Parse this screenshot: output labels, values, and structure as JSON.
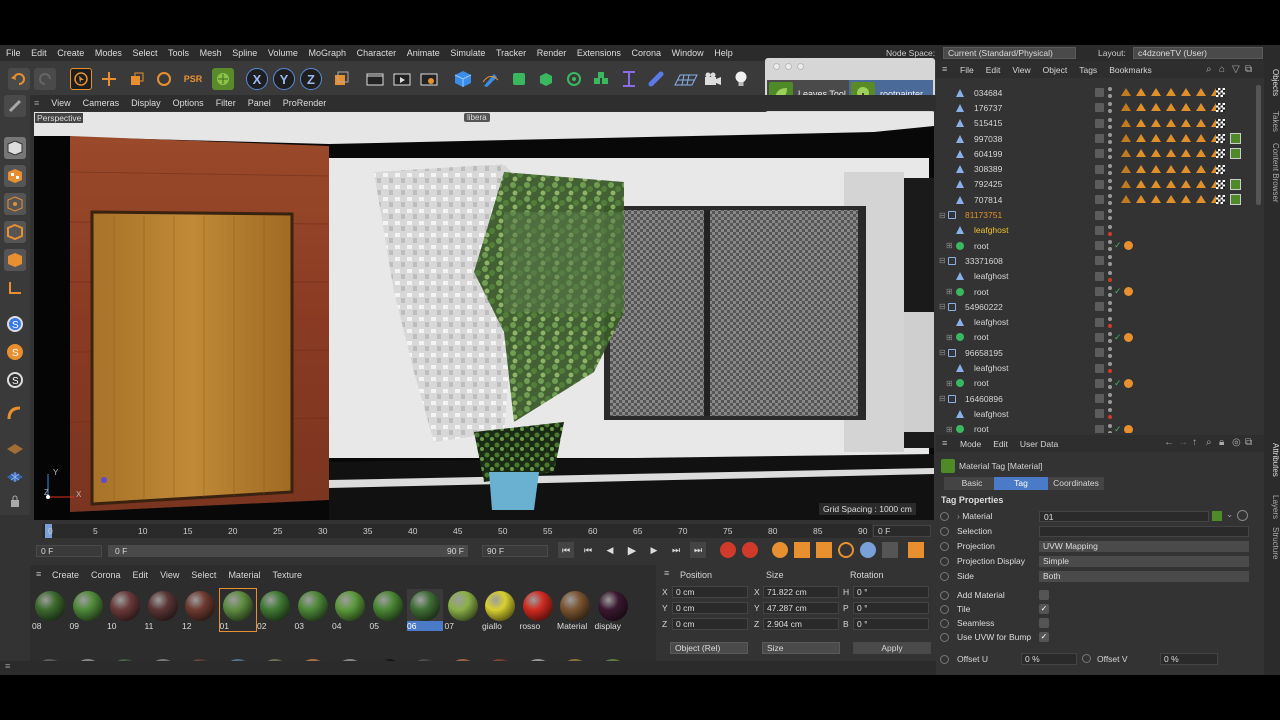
{
  "menubar": {
    "items": [
      "File",
      "Edit",
      "Create",
      "Modes",
      "Select",
      "Tools",
      "Mesh",
      "Spline",
      "Volume",
      "MoGraph",
      "Character",
      "Animate",
      "Simulate",
      "Tracker",
      "Render",
      "Extensions",
      "Corona",
      "Window",
      "Help"
    ],
    "node_space_label": "Node Space:",
    "node_space_value": "Current (Standard/Physical)",
    "layout_label": "Layout:",
    "layout_value": "c4dzoneTV (User)"
  },
  "plugin_panel": {
    "leaves_tool": "Leaves Tool",
    "rootpainter": "rootpainter"
  },
  "viewport": {
    "menu": [
      "View",
      "Cameras",
      "Display",
      "Options",
      "Filter",
      "Panel",
      "ProRender"
    ],
    "camera": "Perspective",
    "grid_spacing": "Grid Spacing : 1000 cm",
    "axis_y": "Y",
    "axis_z": "Z",
    "axis_x": "X",
    "top_label": "libera"
  },
  "timeline": {
    "ticks": [
      "0",
      "5",
      "10",
      "15",
      "20",
      "25",
      "30",
      "35",
      "40",
      "45",
      "50",
      "55",
      "60",
      "65",
      "70",
      "75",
      "80",
      "85",
      "90"
    ],
    "current_frame": "0 F",
    "start_frame": "0 F",
    "preview_start": "0 F",
    "preview_end": "90 F",
    "end_frame": "90 F"
  },
  "material_manager": {
    "menu": [
      "Create",
      "Corona",
      "Edit",
      "View",
      "Select",
      "Material",
      "Texture"
    ],
    "materials": [
      {
        "name": "08",
        "color": "#3d6a2e"
      },
      {
        "name": "09",
        "color": "#4f8a3a"
      },
      {
        "name": "10",
        "color": "#6a3a3a"
      },
      {
        "name": "11",
        "color": "#5a3535"
      },
      {
        "name": "12",
        "color": "#6e3a30"
      },
      {
        "name": "01",
        "color": "#5d8c40"
      },
      {
        "name": "02",
        "color": "#3f7a33"
      },
      {
        "name": "03",
        "color": "#4d8738"
      },
      {
        "name": "04",
        "color": "#5c9a3c"
      },
      {
        "name": "05",
        "color": "#4a8735"
      },
      {
        "name": "06",
        "color": "#3f6e35"
      },
      {
        "name": "07",
        "color": "#8ab048"
      },
      {
        "name": "giallo",
        "color": "#d8d030"
      },
      {
        "name": "rosso",
        "color": "#d02a20"
      },
      {
        "name": "Material",
        "color": "#7a5430"
      },
      {
        "name": "display",
        "color": "#3a1830"
      }
    ],
    "selected_material": "06",
    "second_row_colors": [
      "#555",
      "#888",
      "#3a5a3a",
      "#777",
      "#5a3a30",
      "#4a7090",
      "#6a6a50",
      "#b07040",
      "#8a8a8a",
      "#111",
      "#444",
      "#a06040",
      "#7a3a2a",
      "#999",
      "#8a7030",
      "#5a7a3a"
    ]
  },
  "coordinates": {
    "headers": [
      "Position",
      "Size",
      "Rotation"
    ],
    "rows": [
      {
        "axis": "X",
        "pos": "0 cm",
        "size_axis": "X",
        "size": "71.822 cm",
        "rot_axis": "H",
        "rot": "0 °"
      },
      {
        "axis": "Y",
        "pos": "0 cm",
        "size_axis": "Y",
        "size": "47.287 cm",
        "rot_axis": "P",
        "rot": "0 °"
      },
      {
        "axis": "Z",
        "pos": "0 cm",
        "size_axis": "Z",
        "size": "2.904 cm",
        "rot_axis": "B",
        "rot": "0 °"
      }
    ],
    "mode": "Object (Rel)",
    "size_mode": "Size",
    "apply": "Apply"
  },
  "object_manager": {
    "menu": [
      "File",
      "Edit",
      "View",
      "Object",
      "Tags",
      "Bookmarks"
    ],
    "rows": [
      {
        "name": "034684",
        "kind": "bone",
        "level": 1,
        "tags": 7
      },
      {
        "name": "176737",
        "kind": "bone",
        "level": 1,
        "tags": 7
      },
      {
        "name": "515415",
        "kind": "bone",
        "level": 1,
        "tags": 7
      },
      {
        "name": "997038",
        "kind": "bone",
        "level": 1,
        "tags": 8
      },
      {
        "name": "604199",
        "kind": "bone",
        "level": 1,
        "tags": 8
      },
      {
        "name": "308389",
        "kind": "bone",
        "level": 1,
        "tags": 7
      },
      {
        "name": "792425",
        "kind": "bone",
        "level": 1,
        "tags": 8
      },
      {
        "name": "707814",
        "kind": "bone",
        "level": 1,
        "tags": 8
      },
      {
        "name": "81173751",
        "kind": "null",
        "level": 0,
        "tags": 0,
        "color": "#e0902a"
      },
      {
        "name": "leafghost",
        "kind": "bone",
        "level": 1,
        "tags": 0,
        "color": "#f0c030"
      },
      {
        "name": "root",
        "kind": "spline",
        "level": 1,
        "tags": 1
      },
      {
        "name": "33371608",
        "kind": "null",
        "level": 0,
        "tags": 0
      },
      {
        "name": "leafghost",
        "kind": "bone",
        "level": 1,
        "tags": 0
      },
      {
        "name": "root",
        "kind": "spline",
        "level": 1,
        "tags": 1
      },
      {
        "name": "54960222",
        "kind": "null",
        "level": 0,
        "tags": 0
      },
      {
        "name": "leafghost",
        "kind": "bone",
        "level": 1,
        "tags": 0
      },
      {
        "name": "root",
        "kind": "spline",
        "level": 1,
        "tags": 1
      },
      {
        "name": "96658195",
        "kind": "null",
        "level": 0,
        "tags": 0
      },
      {
        "name": "leafghost",
        "kind": "bone",
        "level": 1,
        "tags": 0
      },
      {
        "name": "root",
        "kind": "spline",
        "level": 1,
        "tags": 1
      },
      {
        "name": "16460896",
        "kind": "null",
        "level": 0,
        "tags": 0
      },
      {
        "name": "leafghost",
        "kind": "bone",
        "level": 1,
        "tags": 0
      },
      {
        "name": "root",
        "kind": "spline",
        "level": 1,
        "tags": 1
      }
    ]
  },
  "attributes": {
    "menu": [
      "Mode",
      "Edit",
      "User Data"
    ],
    "title": "Material Tag [Material]",
    "tabs": [
      "Basic",
      "Tag",
      "Coordinates"
    ],
    "active_tab": "Tag",
    "section": "Tag Properties",
    "material_label": "Material",
    "material_value": "01",
    "selection_label": "Selection",
    "projection_label": "Projection",
    "projection_value": "UVW Mapping",
    "projection_display_label": "Projection Display",
    "projection_display_value": "Simple",
    "side_label": "Side",
    "side_value": "Both",
    "add_material_label": "Add Material",
    "tile_label": "Tile",
    "seamless_label": "Seamless",
    "use_uvw_label": "Use UVW for Bump",
    "offset_u_label": "Offset U",
    "offset_u_value": "0 %",
    "offset_v_label": "Offset V",
    "offset_v_value": "0 %"
  },
  "right_tabs": [
    "Objects",
    "Takes",
    "Content Browser",
    "Attributes",
    "Layers",
    "Structure"
  ]
}
